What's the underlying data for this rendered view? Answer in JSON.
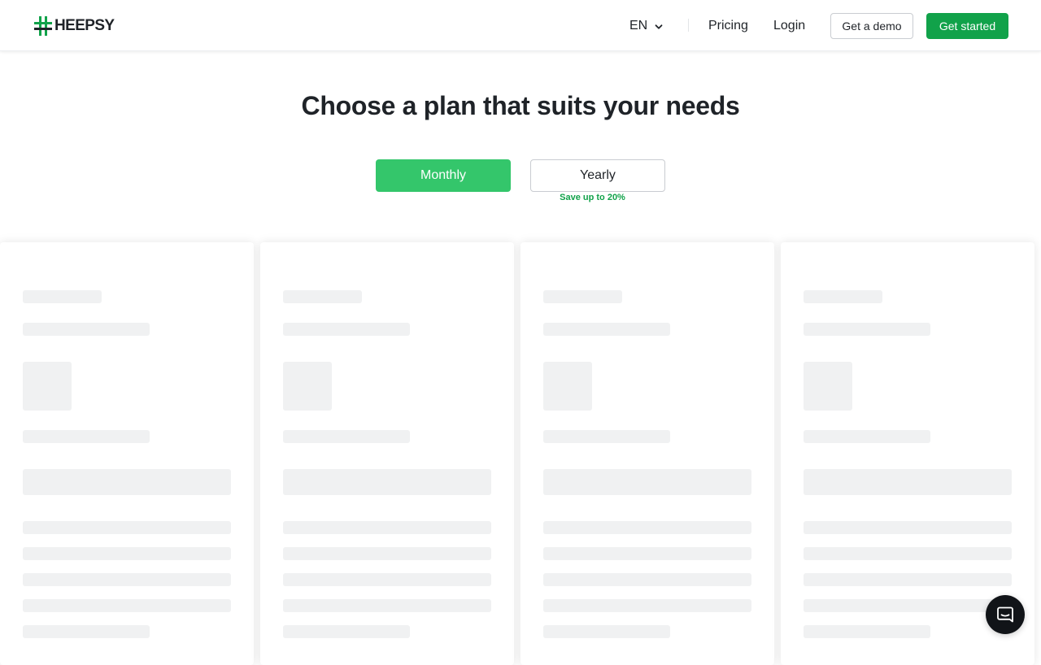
{
  "header": {
    "logo_text": "HEEPSY",
    "language": "EN",
    "nav": {
      "pricing": "Pricing",
      "login": "Login"
    },
    "demo_button": "Get a demo",
    "start_button": "Get started"
  },
  "main": {
    "title": "Choose a plan that suits your needs",
    "billing": {
      "monthly": "Monthly",
      "yearly": "Yearly",
      "selected": "Monthly",
      "yearly_note": "Save up to 20%"
    },
    "plan_cards": [
      {
        "state": "loading"
      },
      {
        "state": "loading"
      },
      {
        "state": "loading"
      },
      {
        "state": "loading"
      }
    ]
  },
  "chat": {
    "icon": "chat-bubble-icon"
  },
  "colors": {
    "brand_green": "#11a24a",
    "toggle_active": "#34c66b",
    "skeleton": "#f0f1f2",
    "text": "#1f2328"
  }
}
